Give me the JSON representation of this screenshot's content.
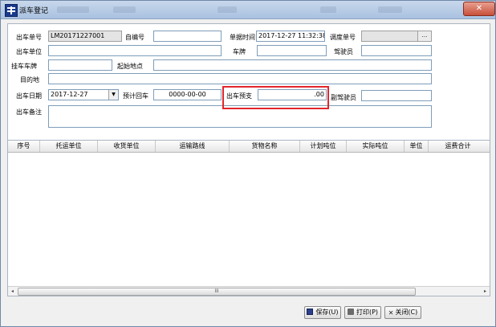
{
  "window": {
    "title": "派车登记",
    "close_glyph": "✕"
  },
  "form": {
    "order_no": {
      "label": "出车单号",
      "value": "LM20171227001"
    },
    "self_no": {
      "label": "自编号",
      "value": ""
    },
    "doc_time": {
      "label": "单据时间",
      "value": "2017-12-27 11:32:38"
    },
    "dispatch_no": {
      "label": "调度单号",
      "value": "",
      "button": "..."
    },
    "unit": {
      "label": "出车单位",
      "value": ""
    },
    "plate": {
      "label": "车牌",
      "value": ""
    },
    "driver": {
      "label": "驾驶员",
      "value": ""
    },
    "trailer": {
      "label": "挂车车牌",
      "value": ""
    },
    "origin": {
      "label": "起始地点",
      "value": ""
    },
    "destination": {
      "label": "目的地",
      "value": ""
    },
    "depart_date": {
      "label": "出车日期",
      "value": "2017-12-27",
      "arrow": "▼"
    },
    "return_est": {
      "label": "预计回车",
      "value": "0000-00-00"
    },
    "advance": {
      "label": "出车预支",
      "value": ".00"
    },
    "co_driver": {
      "label": "副驾驶员",
      "value": ""
    },
    "remark": {
      "label": "出车备注",
      "value": ""
    }
  },
  "grid": {
    "columns": [
      "序号",
      "托运单位",
      "收货单位",
      "运输路线",
      "货物名称",
      "计划吨位",
      "实际吨位",
      "单位",
      "运费合计"
    ],
    "scroll_left": "◂",
    "scroll_right": "▸",
    "thumb_grip": "III"
  },
  "buttons": {
    "save": "保存(U)",
    "print": "打印(P)",
    "close": "关闭(C)",
    "close_glyph": "✕"
  },
  "colors": {
    "highlight": "#e2262c",
    "title_bar": "#b9cde8",
    "close_button": "#c8503a"
  }
}
